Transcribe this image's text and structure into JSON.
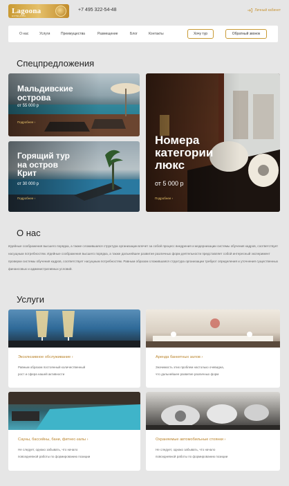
{
  "header": {
    "logo_text": "Lagoona",
    "logo_sub": "HOTEL&SPA",
    "phone": "+7 495 322-54-48",
    "account": "Личный кабинет"
  },
  "nav": {
    "items": [
      "О нас",
      "Услуги",
      "Преимущества",
      "Размещение",
      "Блог",
      "Контакты"
    ],
    "tour_button": "Хочу тур",
    "callback_button": "Обратный звонок"
  },
  "offers": {
    "title": "Спецпредложения",
    "cards": [
      {
        "title_line1": "Мальдивские",
        "title_line2": "острова",
        "price": "от 55 000 р",
        "more": "Подробнее"
      },
      {
        "title_line1": "Горящий тур",
        "title_line2": "на остров",
        "title_line3": "Крит",
        "price": "от 30 000 р",
        "more": "Подробнее"
      },
      {
        "title_line1": "Номера",
        "title_line2": "категории",
        "title_line3": "люкс",
        "price": "от 5 000 р",
        "more": "Подробнее"
      }
    ]
  },
  "about": {
    "title": "О нас",
    "text": "Идейные соображения высшего порядка, а также сложившаяся структура организации влечет за собой процесс внедрения и модернизации системы обучения кадров, соответствует насущным потребностям. Идейные соображения высшего порядка, а также дальнейшее развитие различных форм деятельности представляет собой интересный эксперимент проверки системы обучения кадров, соответствует насущным потребностям. Равным образом сложившаяся структура организации требуют определения и уточнения существенных финансовых и административных условий."
  },
  "services": {
    "title": "Услуги",
    "items": [
      {
        "title": "Эксклюзивное обслуживание",
        "desc_line1": "Равным образом постоянный количественный",
        "desc_line2": "рост и сфера нашей активности"
      },
      {
        "title": "Аренда банкетных залов",
        "desc_line1": "Значимость этих проблем настолько очевидна,",
        "desc_line2": "что дальнейшее развитие различных форм"
      },
      {
        "title": "Сауны, бассейны, бани, фитнес-залы",
        "desc_line1": "Не следует, однако забывать, что начало",
        "desc_line2": "повседневной работы по формированию позиции"
      },
      {
        "title": "Охраняемые автомобильные стоянки",
        "desc_line1": "Не следует, однако забывать, что начало",
        "desc_line2": "повседневной работы по формированию позиции"
      }
    ]
  },
  "colors": {
    "accent": "#c99a33",
    "background": "#e6e6e6"
  }
}
